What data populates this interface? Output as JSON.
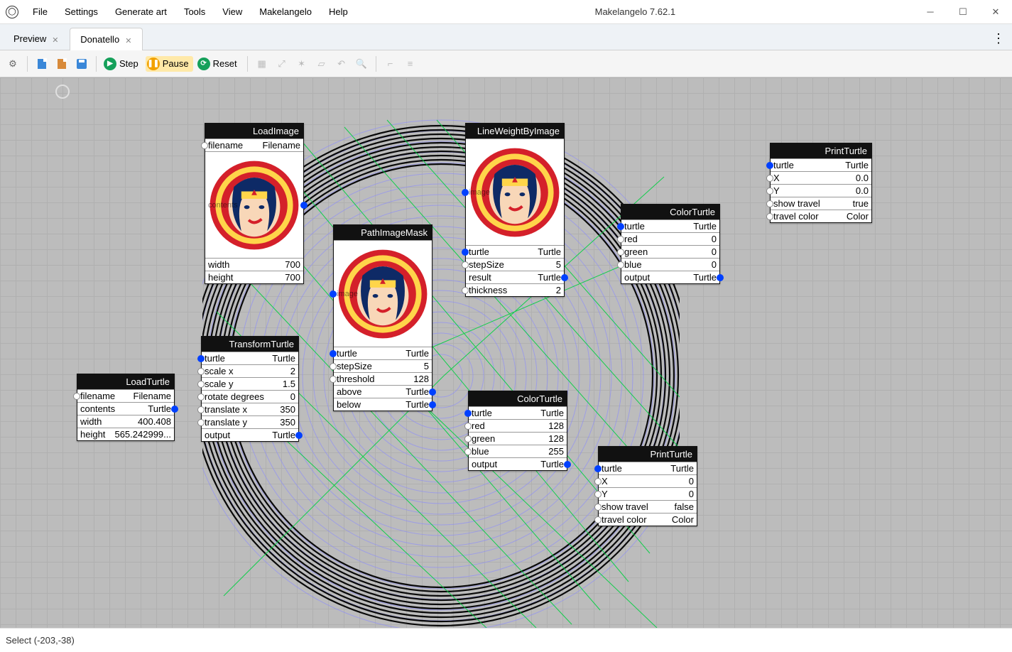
{
  "window": {
    "title": "Makelangelo 7.62.1"
  },
  "menu": [
    "File",
    "Settings",
    "Generate art",
    "Tools",
    "View",
    "Makelangelo",
    "Help"
  ],
  "tabs": [
    {
      "label": "Preview",
      "active": false
    },
    {
      "label": "Donatello",
      "active": true
    }
  ],
  "toolbar": {
    "step": "Step",
    "pause": "Pause",
    "reset": "Reset"
  },
  "status": "Select (-203,-38)",
  "nodes": {
    "loadImage": {
      "title": "LoadImage",
      "rows": [
        [
          "filename",
          "Filename"
        ],
        [
          "width",
          "700"
        ],
        [
          "height",
          "700"
        ]
      ],
      "imageLabel": "contents"
    },
    "loadTurtle": {
      "title": "LoadTurtle",
      "rows": [
        [
          "filename",
          "Filename"
        ],
        [
          "contents",
          "Turtle"
        ],
        [
          "width",
          "400.408"
        ],
        [
          "height",
          "565.242999..."
        ]
      ]
    },
    "transformTurtle": {
      "title": "TransformTurtle",
      "rows": [
        [
          "turtle",
          "Turtle"
        ],
        [
          "scale x",
          "2"
        ],
        [
          "scale y",
          "1.5"
        ],
        [
          "rotate degrees",
          "0"
        ],
        [
          "translate x",
          "350"
        ],
        [
          "translate y",
          "350"
        ],
        [
          "output",
          "Turtle"
        ]
      ]
    },
    "pathImageMask": {
      "title": "PathImageMask",
      "rows": [
        [
          "turtle",
          "Turtle"
        ],
        [
          "stepSize",
          "5"
        ],
        [
          "threshold",
          "128"
        ],
        [
          "above",
          "Turtle"
        ],
        [
          "below",
          "Turtle"
        ]
      ],
      "imageLabel": "image"
    },
    "lineWeightByImage": {
      "title": "LineWeightByImage",
      "rows": [
        [
          "turtle",
          "Turtle"
        ],
        [
          "stepSize",
          "5"
        ],
        [
          "result",
          "Turtle"
        ],
        [
          "thickness",
          "2"
        ]
      ],
      "imageLabel": "image"
    },
    "colorTurtle1": {
      "title": "ColorTurtle",
      "rows": [
        [
          "turtle",
          "Turtle"
        ],
        [
          "red",
          "0"
        ],
        [
          "green",
          "0"
        ],
        [
          "blue",
          "0"
        ],
        [
          "output",
          "Turtle"
        ]
      ]
    },
    "colorTurtle2": {
      "title": "ColorTurtle",
      "rows": [
        [
          "turtle",
          "Turtle"
        ],
        [
          "red",
          "128"
        ],
        [
          "green",
          "128"
        ],
        [
          "blue",
          "255"
        ],
        [
          "output",
          "Turtle"
        ]
      ]
    },
    "printTurtle1": {
      "title": "PrintTurtle",
      "rows": [
        [
          "turtle",
          "Turtle"
        ],
        [
          "X",
          "0.0"
        ],
        [
          "Y",
          "0.0"
        ],
        [
          "show travel",
          "true"
        ],
        [
          "travel color",
          "Color"
        ]
      ]
    },
    "printTurtle2": {
      "title": "PrintTurtle",
      "rows": [
        [
          "turtle",
          "Turtle"
        ],
        [
          "X",
          "0"
        ],
        [
          "Y",
          "0"
        ],
        [
          "show travel",
          "false"
        ],
        [
          "travel color",
          "Color"
        ]
      ]
    }
  }
}
